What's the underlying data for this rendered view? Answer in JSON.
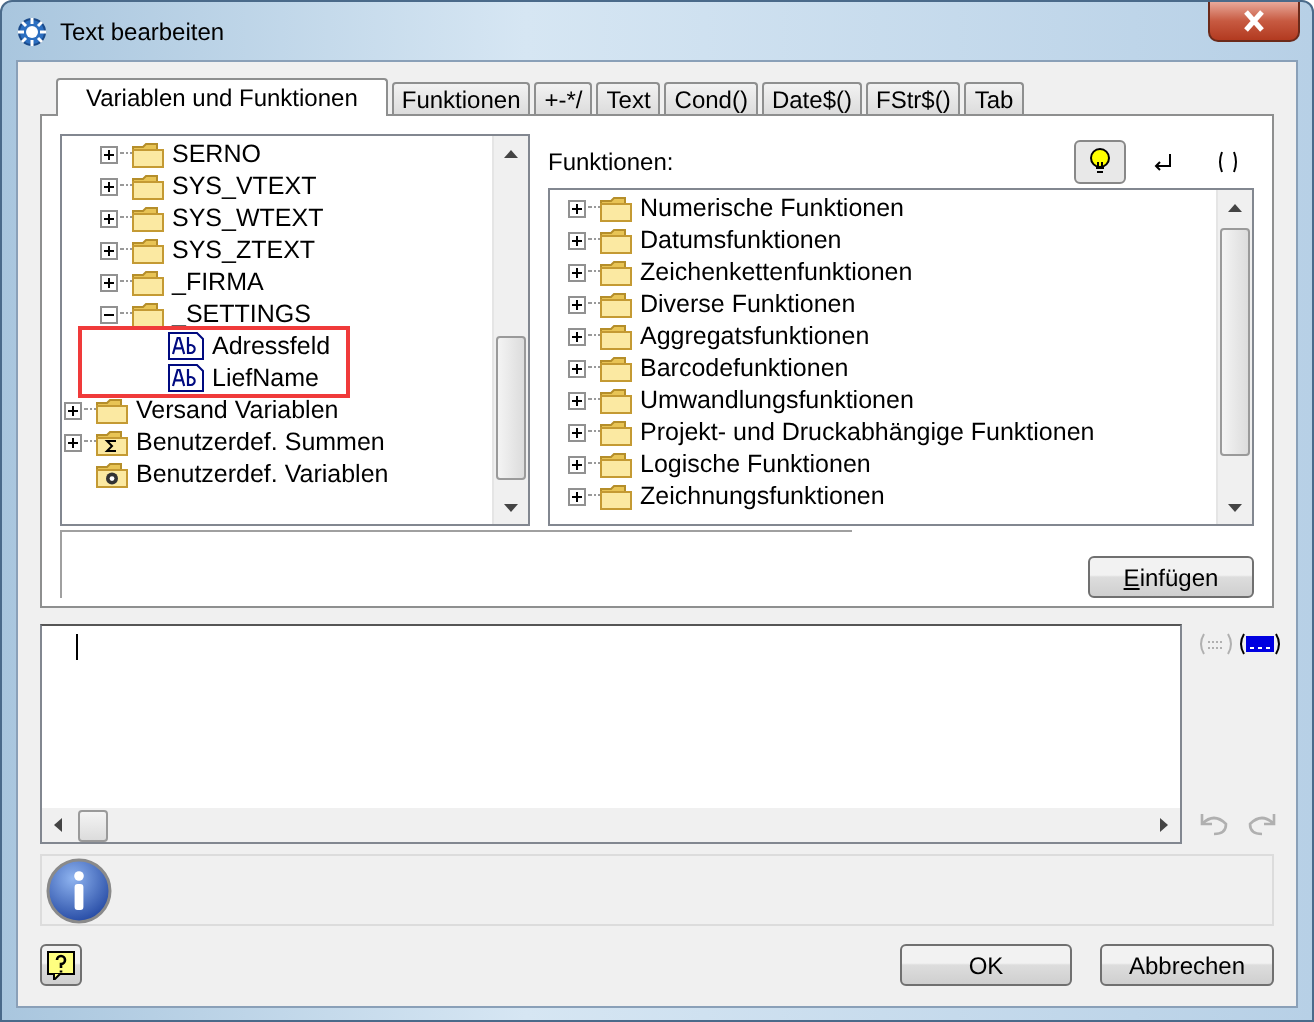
{
  "window": {
    "title": "Text bearbeiten"
  },
  "tabs": [
    {
      "label": "Variablen und Funktionen",
      "selected": true
    },
    {
      "label": "Funktionen",
      "selected": false
    },
    {
      "label": "+-*/",
      "selected": false
    },
    {
      "label": "Text",
      "selected": false
    },
    {
      "label": "Cond()",
      "selected": false
    },
    {
      "label": "Date$()",
      "selected": false
    },
    {
      "label": "FStr$()",
      "selected": false
    },
    {
      "label": "Tab",
      "selected": false
    }
  ],
  "variables_tree": {
    "items": [
      {
        "children": [
          {
            "label": "SERNO",
            "kind": "folder",
            "expandable": true,
            "expanded": false
          },
          {
            "label": "SYS_VTEXT",
            "kind": "folder",
            "expandable": true,
            "expanded": false
          },
          {
            "label": "SYS_WTEXT",
            "kind": "folder",
            "expandable": true,
            "expanded": false
          },
          {
            "label": "SYS_ZTEXT",
            "kind": "folder",
            "expandable": true,
            "expanded": false
          },
          {
            "label": "_FIRMA",
            "kind": "folder",
            "expandable": true,
            "expanded": false
          },
          {
            "label": "_SETTINGS",
            "kind": "folder",
            "expandable": true,
            "expanded": true,
            "children": [
              {
                "label": "Adressfeld",
                "kind": "text-field"
              },
              {
                "label": "LiefName",
                "kind": "text-field"
              }
            ]
          }
        ]
      },
      {
        "label": "Versand Variablen",
        "kind": "folder",
        "expandable": true,
        "expanded": false
      },
      {
        "label": "Benutzerdef. Summen",
        "kind": "sum-folder",
        "expandable": true,
        "expanded": false
      },
      {
        "label": "Benutzerdef. Variablen",
        "kind": "var-folder",
        "expandable": false
      }
    ]
  },
  "functions": {
    "label": "Funktionen:",
    "toolbar": [
      {
        "kind": "lightbulb",
        "pressed": true
      },
      {
        "kind": "return",
        "pressed": false
      },
      {
        "kind": "parens",
        "pressed": false
      }
    ],
    "items": [
      {
        "label": "Numerische Funktionen",
        "kind": "folder",
        "expandable": true,
        "expanded": false
      },
      {
        "label": "Datumsfunktionen",
        "kind": "folder",
        "expandable": true,
        "expanded": false
      },
      {
        "label": "Zeichenkettenfunktionen",
        "kind": "folder",
        "expandable": true,
        "expanded": false
      },
      {
        "label": "Diverse Funktionen",
        "kind": "folder",
        "expandable": true,
        "expanded": false
      },
      {
        "label": "Aggregatsfunktionen",
        "kind": "folder",
        "expandable": true,
        "expanded": false
      },
      {
        "label": "Barcodefunktionen",
        "kind": "folder",
        "expandable": true,
        "expanded": false
      },
      {
        "label": "Umwandlungsfunktionen",
        "kind": "folder",
        "expandable": true,
        "expanded": false
      },
      {
        "label": "Projekt- und Druckabhängige Funktionen",
        "kind": "folder",
        "expandable": true,
        "expanded": false
      },
      {
        "label": "Logische Funktionen",
        "kind": "folder",
        "expandable": true,
        "expanded": false
      },
      {
        "label": "Zeichnungsfunktionen",
        "kind": "folder",
        "expandable": true,
        "expanded": false
      }
    ]
  },
  "insert_button": "Einfügen",
  "editor_tools": [
    {
      "kind": "wrap",
      "disabled": true
    },
    {
      "kind": "field",
      "disabled": false
    },
    {
      "kind": "undo",
      "disabled": true
    },
    {
      "kind": "redo",
      "disabled": true
    }
  ],
  "buttons": [
    "OK",
    "Abbrechen"
  ]
}
